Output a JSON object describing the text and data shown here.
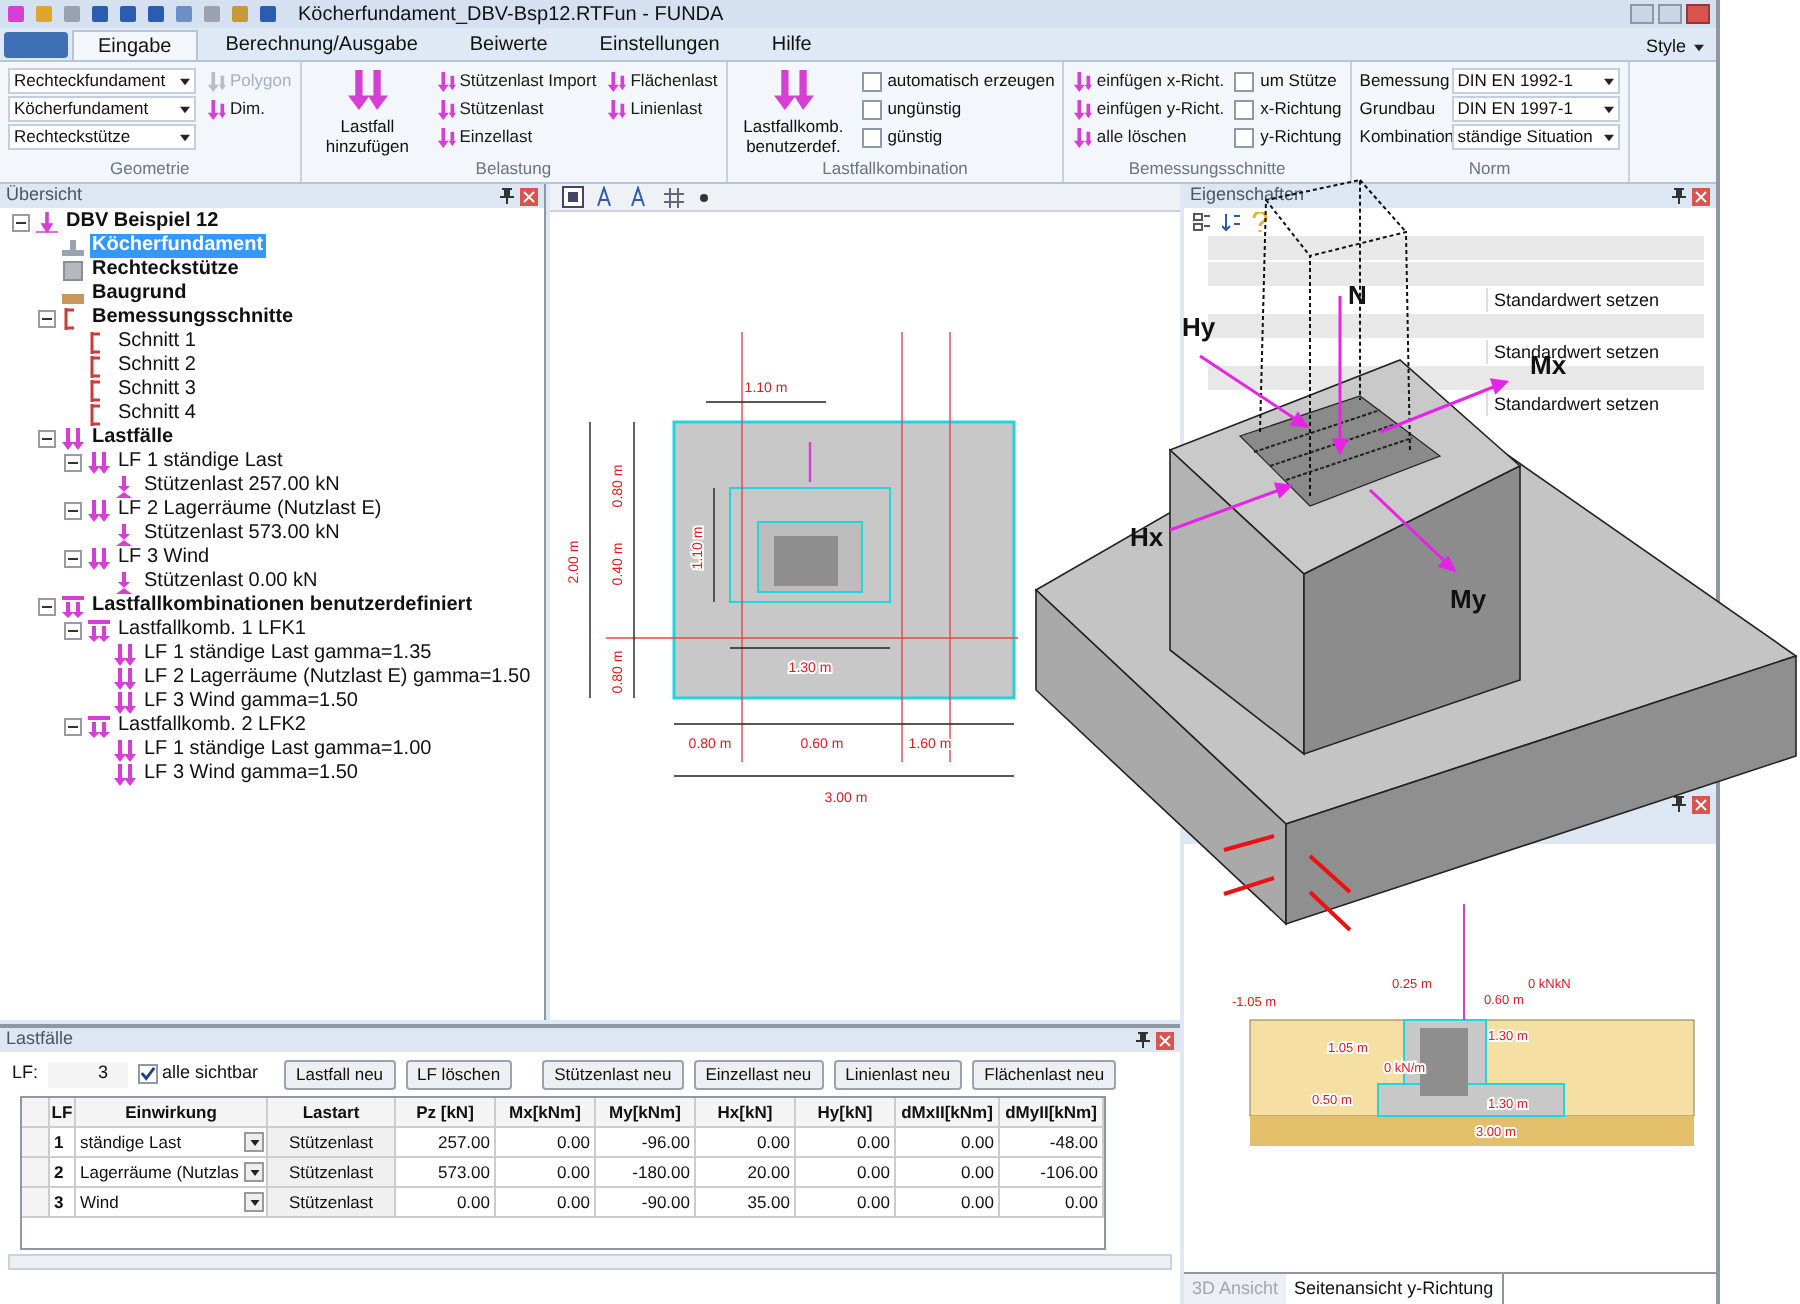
{
  "window": {
    "title": "Köcherfundament_DBV-Bsp12.RTFun - FUNDA"
  },
  "tabs": [
    {
      "label": "Eingabe",
      "selected": true
    },
    {
      "label": "Berechnung/Ausgabe",
      "selected": false
    },
    {
      "label": "Beiwerte",
      "selected": false
    },
    {
      "label": "Einstellungen",
      "selected": false
    },
    {
      "label": "Hilfe",
      "selected": false
    }
  ],
  "style_menu": "Style",
  "ribbon": [
    {
      "label": "Geometrie",
      "columns": [
        [
          {
            "kind": "dropdown",
            "text": "Rechteckfundament"
          },
          {
            "kind": "dropdown",
            "text": "Köcherfundament"
          },
          {
            "kind": "dropdown",
            "text": "Rechteckstütze"
          }
        ],
        [
          {
            "kind": "button",
            "text": "Polygon",
            "disabled": true
          },
          {
            "kind": "button",
            "text": "Dim.",
            "disabled": false
          }
        ]
      ]
    },
    {
      "label": "Belastung",
      "columns": [
        [
          {
            "kind": "large",
            "text": "Lastfall hinzufügen"
          }
        ],
        [
          {
            "kind": "button",
            "text": "Stützenlast Import",
            "disabled": false
          },
          {
            "kind": "button",
            "text": "Stützenlast",
            "disabled": false
          },
          {
            "kind": "button",
            "text": "Einzellast",
            "disabled": false
          }
        ],
        [
          {
            "kind": "button",
            "text": "Flächenlast",
            "disabled": false
          },
          {
            "kind": "button",
            "text": "Linienlast",
            "disabled": false
          }
        ]
      ]
    },
    {
      "label": "Lastfallkombination",
      "columns": [
        [
          {
            "kind": "large",
            "text": "Lastfallkomb. benutzerdef."
          }
        ],
        [
          {
            "kind": "checkbox",
            "text": "automatisch erzeugen",
            "checked": false
          },
          {
            "kind": "checkbox",
            "text": "ungünstig",
            "checked": false
          },
          {
            "kind": "checkbox",
            "text": "günstig",
            "checked": false
          }
        ]
      ]
    },
    {
      "label": "Bemessungsschnitte",
      "columns": [
        [
          {
            "kind": "button",
            "text": "einfügen x-Richt.",
            "disabled": false
          },
          {
            "kind": "button",
            "text": "einfügen y-Richt.",
            "disabled": false
          },
          {
            "kind": "button",
            "text": "alle löschen",
            "disabled": false
          }
        ],
        [
          {
            "kind": "checkbox",
            "text": "um Stütze",
            "checked": false
          },
          {
            "kind": "checkbox",
            "text": "x-Richtung",
            "checked": false
          },
          {
            "kind": "checkbox",
            "text": "y-Richtung",
            "checked": false
          }
        ]
      ]
    },
    {
      "label": "Norm",
      "columns": [
        [
          {
            "kind": "field",
            "label": "Bemessung",
            "text": "DIN EN 1992-1"
          },
          {
            "kind": "field",
            "label": "Grundbau",
            "text": "DIN EN 1997-1"
          },
          {
            "kind": "field",
            "label": "Kombination",
            "text": "ständige Situation"
          }
        ]
      ]
    }
  ],
  "overview": {
    "title": "Übersicht",
    "tree": [
      {
        "label": "DBV Beispiel 12",
        "kind": "project",
        "bold": true,
        "selected": false,
        "expanded": true,
        "children": [
          {
            "label": "Köcherfundament",
            "kind": "foundation",
            "bold": true,
            "selected": true
          },
          {
            "label": "Rechteckstütze",
            "kind": "column",
            "bold": true,
            "selected": false
          },
          {
            "label": "Baugrund",
            "kind": "soil",
            "bold": true,
            "selected": false
          },
          {
            "label": "Bemessungsschnitte",
            "kind": "section",
            "bold": true,
            "selected": false,
            "expanded": true,
            "children": [
              {
                "label": "Schnitt 1",
                "kind": "section",
                "bold": false,
                "selected": false
              },
              {
                "label": "Schnitt 2",
                "kind": "section",
                "bold": false,
                "selected": false
              },
              {
                "label": "Schnitt 3",
                "kind": "section",
                "bold": false,
                "selected": false
              },
              {
                "label": "Schnitt 4",
                "kind": "section",
                "bold": false,
                "selected": false
              }
            ]
          },
          {
            "label": "Lastfälle",
            "kind": "loadcase",
            "bold": true,
            "selected": false,
            "expanded": true,
            "children": [
              {
                "label": "LF 1 ständige Last",
                "kind": "loadcase",
                "bold": false,
                "selected": false,
                "expanded": true,
                "children": [
                  {
                    "label": "Stützenlast 257.00 kN",
                    "kind": "load",
                    "bold": false,
                    "selected": false
                  }
                ]
              },
              {
                "label": "LF 2 Lagerräume (Nutzlast E)",
                "kind": "loadcase",
                "bold": false,
                "selected": false,
                "expanded": true,
                "children": [
                  {
                    "label": "Stützenlast 573.00 kN",
                    "kind": "load",
                    "bold": false,
                    "selected": false
                  }
                ]
              },
              {
                "label": "LF 3 Wind",
                "kind": "loadcase",
                "bold": false,
                "selected": false,
                "expanded": true,
                "children": [
                  {
                    "label": "Stützenlast 0.00 kN",
                    "kind": "load",
                    "bold": false,
                    "selected": false
                  }
                ]
              }
            ]
          },
          {
            "label": "Lastfallkombinationen benutzerdefiniert",
            "kind": "combination",
            "bold": true,
            "selected": false,
            "expanded": true,
            "children": [
              {
                "label": "Lastfallkomb. 1 LFK1",
                "kind": "combination",
                "bold": false,
                "selected": false,
                "expanded": true,
                "children": [
                  {
                    "label": "LF 1 ständige Last gamma=1.35",
                    "kind": "loadcase",
                    "bold": false,
                    "selected": false
                  },
                  {
                    "label": "LF 2 Lagerräume (Nutzlast E) gamma=1.50",
                    "kind": "loadcase",
                    "bold": false,
                    "selected": false
                  },
                  {
                    "label": "LF 3 Wind gamma=1.50",
                    "kind": "loadcase",
                    "bold": false,
                    "selected": false
                  }
                ]
              },
              {
                "label": "Lastfallkomb. 2 LFK2",
                "kind": "combination",
                "bold": false,
                "selected": false,
                "expanded": true,
                "children": [
                  {
                    "label": "LF 1 ständige Last gamma=1.00",
                    "kind": "loadcase",
                    "bold": false,
                    "selected": false
                  },
                  {
                    "label": "LF 3 Wind gamma=1.50",
                    "kind": "loadcase",
                    "bold": false,
                    "selected": false
                  }
                ]
              }
            ]
          }
        ]
      }
    ]
  },
  "plan_view": {
    "labels": [
      "1.10 m",
      "0.80 m",
      "0.40 m",
      "0.80 m",
      "2.00 m",
      "1.10 m",
      "1.30 m",
      "0.80 m",
      "0.60 m",
      "1.60 m",
      "3.00 m"
    ]
  },
  "loadcases": {
    "title": "Lastfälle",
    "lf_label": "LF:",
    "lf_value": "3",
    "show_all": {
      "label": "alle sichtbar",
      "checked": true
    },
    "buttons": [
      "Lastfall neu",
      "LF löschen",
      "Stützenlast neu",
      "Einzellast neu",
      "Linienlast neu",
      "Flächenlast neu"
    ],
    "columns": [
      "LF",
      "Einwirkung",
      "Lastart",
      "Pz [kN]",
      "Mx[kNm]",
      "My[kNm]",
      "Hx[kN]",
      "Hy[kN]",
      "dMxII[kNm]",
      "dMyII[kNm]"
    ],
    "rows": [
      [
        "1",
        "ständige Last",
        "Stützenlast",
        "257.00",
        "0.00",
        "-96.00",
        "0.00",
        "0.00",
        "0.00",
        "-48.00"
      ],
      [
        "2",
        "Lagerräume (Nutzlas",
        "Stützenlast",
        "573.00",
        "0.00",
        "-180.00",
        "20.00",
        "0.00",
        "0.00",
        "-106.00"
      ],
      [
        "3",
        "Wind",
        "Stützenlast",
        "0.00",
        "0.00",
        "-90.00",
        "35.00",
        "0.00",
        "0.00",
        "0.00"
      ]
    ]
  },
  "properties": {
    "title": "Eigenschaften",
    "values": [
      "Standardwert setzen",
      "Standardwert setzen",
      "Standardwert setzen"
    ]
  },
  "side_view": {
    "labels": [
      "-1.05 m",
      "0.25 m",
      "0.60 m",
      "0 kNkN",
      "1.30 m",
      "1.05 m",
      "0 kN/m",
      "1.30 m",
      "0.50 m",
      "3.00 m"
    ],
    "tabs": [
      {
        "label": "3D Ansicht",
        "selected": false
      },
      {
        "label": "Seitenansicht y-Richtung",
        "selected": true
      }
    ]
  },
  "model_3d": {
    "labels": [
      "N",
      "Hy",
      "Mx",
      "Hx",
      "My"
    ]
  }
}
